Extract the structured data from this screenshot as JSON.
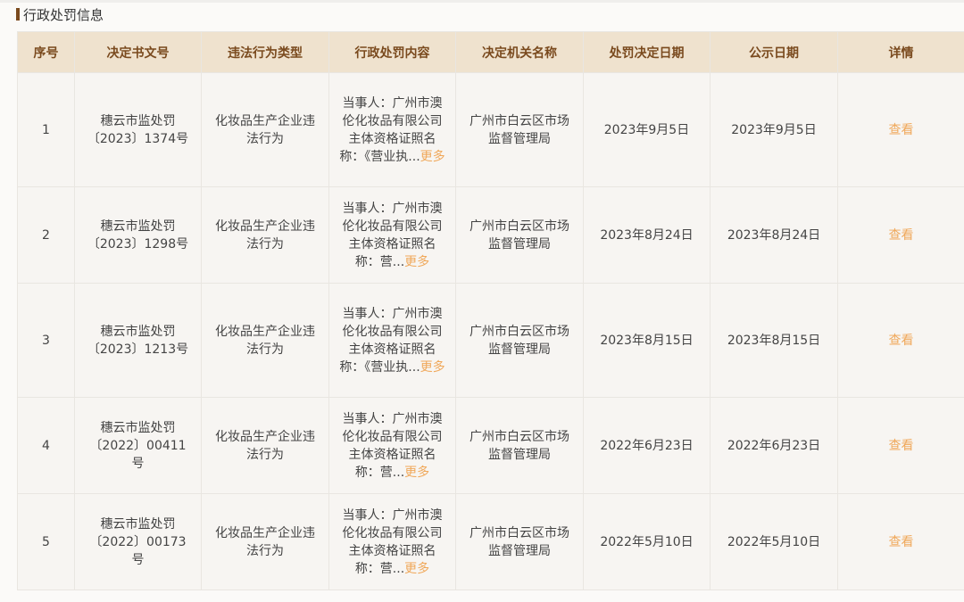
{
  "section": {
    "title": "行政处罚信息"
  },
  "table": {
    "headers": [
      "序号",
      "决定书文号",
      "违法行为类型",
      "行政处罚内容",
      "决定机关名称",
      "处罚决定日期",
      "公示日期",
      "详情"
    ],
    "rows": [
      {
        "index": "1",
        "doc_no": "穗云市监处罚〔2023〕1374号",
        "violation_type": "化妆品生产企业违法行为",
        "content": "当事人：广州市澳伦化妆品有限公司主体资格证照名称：《营业执...",
        "more": "更多",
        "org": "广州市白云区市场监督管理局",
        "decision_date": "2023年9月5日",
        "publish_date": "2023年9月5日",
        "detail": "查看"
      },
      {
        "index": "2",
        "doc_no": "穗云市监处罚〔2023〕1298号",
        "violation_type": "化妆品生产企业违法行为",
        "content": "当事人：广州市澳伦化妆品有限公司主体资格证照名称：营...",
        "more": "更多",
        "org": "广州市白云区市场监督管理局",
        "decision_date": "2023年8月24日",
        "publish_date": "2023年8月24日",
        "detail": "查看"
      },
      {
        "index": "3",
        "doc_no": "穗云市监处罚〔2023〕1213号",
        "violation_type": "化妆品生产企业违法行为",
        "content": "当事人：广州市澳伦化妆品有限公司主体资格证照名称：《营业执...",
        "more": "更多",
        "org": "广州市白云区市场监督管理局",
        "decision_date": "2023年8月15日",
        "publish_date": "2023年8月15日",
        "detail": "查看"
      },
      {
        "index": "4",
        "doc_no": "穗云市监处罚〔2022〕00411号",
        "violation_type": "化妆品生产企业违法行为",
        "content": "当事人：广州市澳伦化妆品有限公司主体资格证照名称：营...",
        "more": "更多",
        "org": "广州市白云区市场监督管理局",
        "decision_date": "2022年6月23日",
        "publish_date": "2022年6月23日",
        "detail": "查看"
      },
      {
        "index": "5",
        "doc_no": "穗云市监处罚〔2022〕00173号",
        "violation_type": "化妆品生产企业违法行为",
        "content": "当事人：广州市澳伦化妆品有限公司主体资格证照名称：营...",
        "more": "更多",
        "org": "广州市白云区市场监督管理局",
        "decision_date": "2022年5月10日",
        "publish_date": "2022年5月10日",
        "detail": "查看"
      }
    ]
  },
  "colors": {
    "header_bg": "#efe2ce",
    "header_text": "#7a4a1e",
    "link": "#f0a85a",
    "title_marker": "#7a4a1e"
  }
}
